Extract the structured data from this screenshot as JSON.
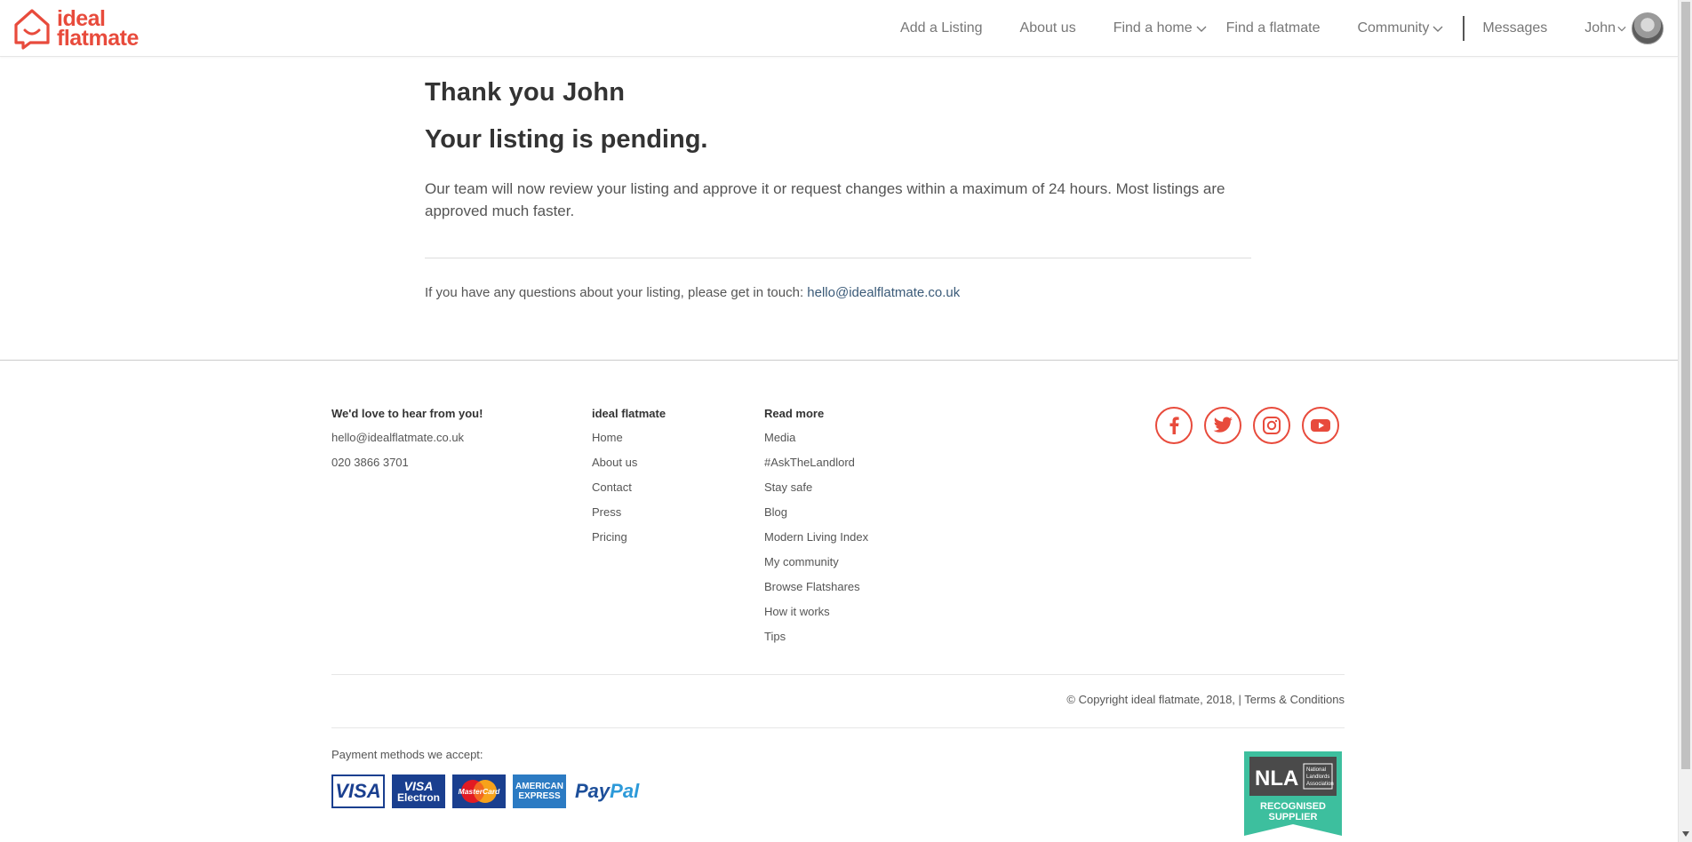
{
  "header": {
    "logo_line1": "ideal",
    "logo_line2": "flatmate",
    "nav": {
      "add_listing": "Add a Listing",
      "about": "About us",
      "find_home": "Find a home",
      "find_flatmate": "Find a flatmate",
      "community": "Community",
      "messages": "Messages",
      "user": "John"
    }
  },
  "main": {
    "heading": "Thank you John",
    "subheading": "Your listing is pending.",
    "message": "Our team will now review your listing and approve it or request changes within a maximum of 24 hours. Most listings are approved much faster.",
    "contact_prefix": "If you have any questions about your listing, please get in touch: ",
    "contact_email": "hello@idealflatmate.co.uk"
  },
  "footer": {
    "col1": {
      "title": "We'd love to hear from you!",
      "email": "hello@idealflatmate.co.uk",
      "phone": "020 3866 3701"
    },
    "col2": {
      "title": "ideal flatmate",
      "links": [
        "Home",
        "About us",
        "Contact",
        "Press",
        "Pricing"
      ]
    },
    "col3": {
      "title": "Read more",
      "links": [
        "Media",
        "#AskTheLandlord",
        "Stay safe",
        "Blog",
        "Modern Living Index",
        "My community",
        "Browse Flatshares",
        "How it works",
        "Tips"
      ]
    },
    "copyright": "© Copyright ideal flatmate, 2018, | ",
    "terms": "Terms & Conditions",
    "payment_label": "Payment methods we accept:",
    "cards": {
      "visa": "VISA",
      "visa_electron_1": "VISA",
      "visa_electron_2": "Electron",
      "mastercard": "MasterCard",
      "amex_1": "AMERICAN",
      "amex_2": "EXPRESS",
      "paypal_1": "Pay",
      "paypal_2": "Pal"
    },
    "nla": {
      "abbr": "NLA",
      "full1": "National",
      "full2": "Landlords",
      "full3": "Association",
      "badge1": "RECOGNISED",
      "badge2": "SUPPLIER"
    }
  },
  "colors": {
    "brand": "#e84b3c",
    "link": "#3a5a78",
    "nla_green": "#3dbf9e"
  }
}
